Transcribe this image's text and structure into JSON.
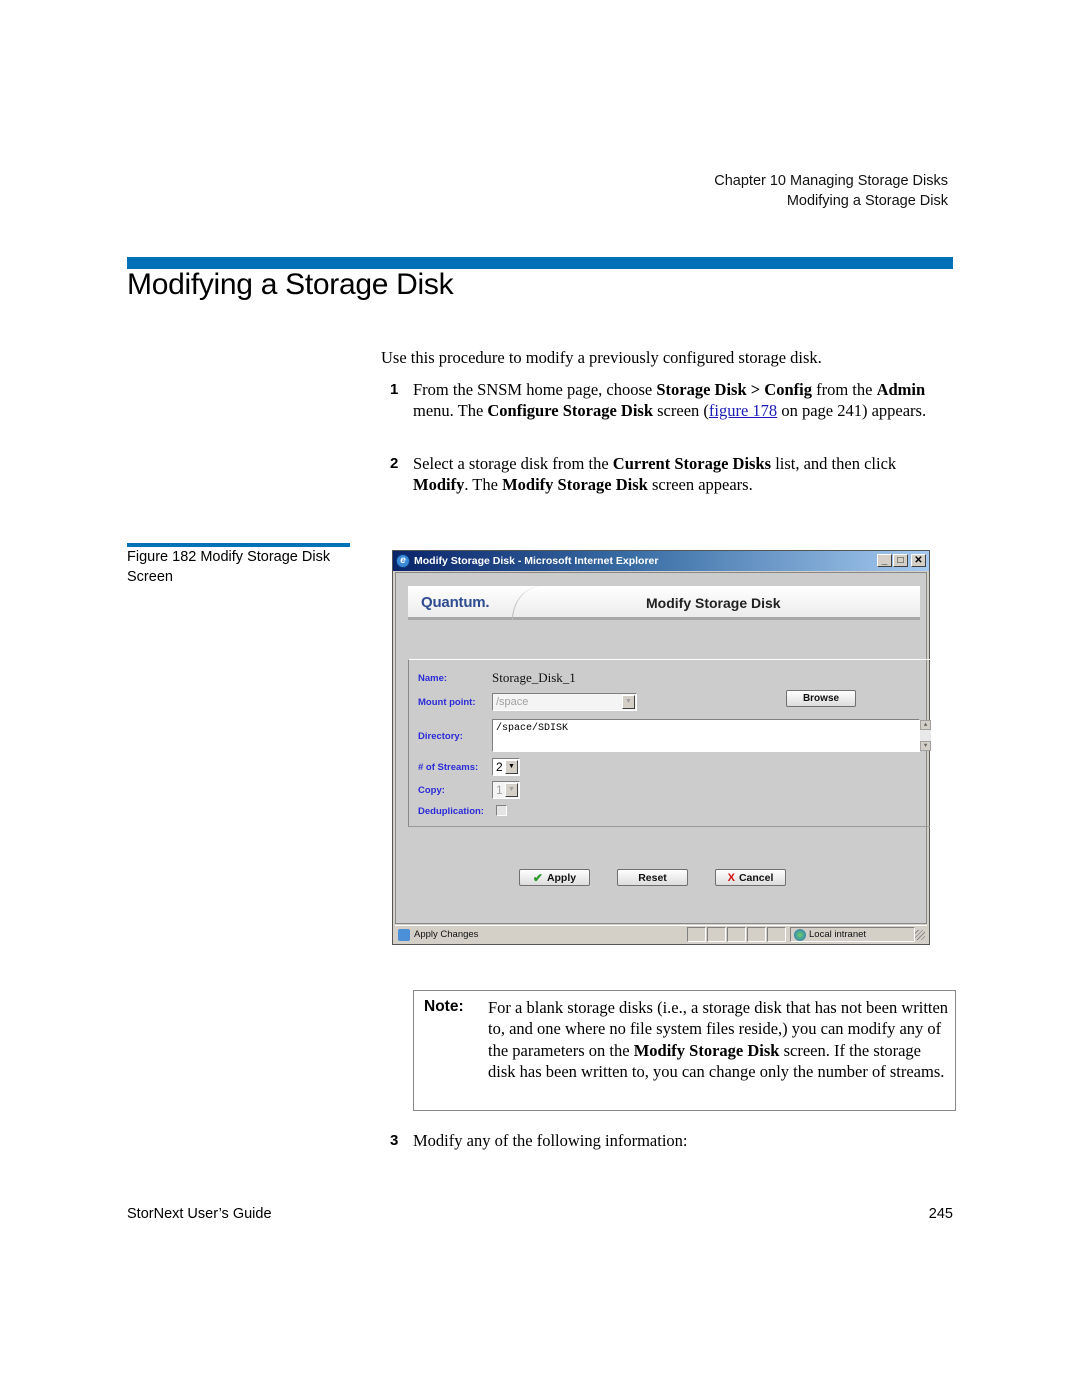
{
  "running_head": {
    "chapter": "Chapter 10  Managing Storage Disks",
    "section": "Modifying a Storage Disk"
  },
  "page_title": "Modifying a Storage Disk",
  "intro": "Use this procedure to modify a previously configured storage disk.",
  "steps": [
    {
      "num": "1",
      "parts": {
        "a": "From the SNSM home page, choose ",
        "b": "Storage Disk > Config",
        "c": " from the ",
        "d": "Admin",
        "e": " menu. The ",
        "f": "Configure Storage Disk",
        "g": " screen (",
        "link": "figure 178",
        "h": " on page 241) appears."
      }
    },
    {
      "num": "2",
      "parts": {
        "a": "Select a storage disk from the ",
        "b": "Current Storage Disks",
        "c": " list, and then click ",
        "d": "Modify",
        "e": ". The ",
        "f": "Modify Storage Disk",
        "g": " screen appears."
      }
    },
    {
      "num": "3",
      "text": "Modify any of the following information:"
    }
  ],
  "figure": {
    "caption": "Figure 182  Modify Storage Disk Screen"
  },
  "ie_window": {
    "title": "Modify Storage Disk - Microsoft Internet Explorer",
    "controls": {
      "minimize": "_",
      "maximize": "□",
      "close": "✕"
    },
    "banner": {
      "logo": "Quantum.",
      "heading": "Modify Storage Disk"
    },
    "form": {
      "name_label": "Name:",
      "name_value": "Storage_Disk_1",
      "mount_label": "Mount point:",
      "mount_value": "/space",
      "browse_label": "Browse",
      "directory_label": "Directory:",
      "directory_value": "/space/SDISK",
      "streams_label": "# of Streams:",
      "streams_value": "2",
      "copy_label": "Copy:",
      "copy_value": "1",
      "dedup_label": "Deduplication:",
      "dedup_checked": false
    },
    "buttons": {
      "apply": "Apply",
      "reset": "Reset",
      "cancel": "Cancel"
    },
    "status_bar": {
      "text": "Apply Changes",
      "zone": "Local intranet"
    },
    "colors": {
      "label_blue": "#2b2bd9",
      "logo_blue": "#2f4c90"
    }
  },
  "note": {
    "label": "Note:",
    "a": "For a blank storage disks (i.e., a storage disk that has not been written to, and one where no file system files reside,) you can modify any of the parameters on the ",
    "b": "Modify Storage Disk",
    "c": " screen. If the storage disk has been written to, you can change only the number of streams."
  },
  "footer": {
    "guide": "StorNext User’s Guide",
    "page": "245"
  },
  "colors": {
    "accent_rule": "#0070b8",
    "link": "#1a1ab5"
  }
}
